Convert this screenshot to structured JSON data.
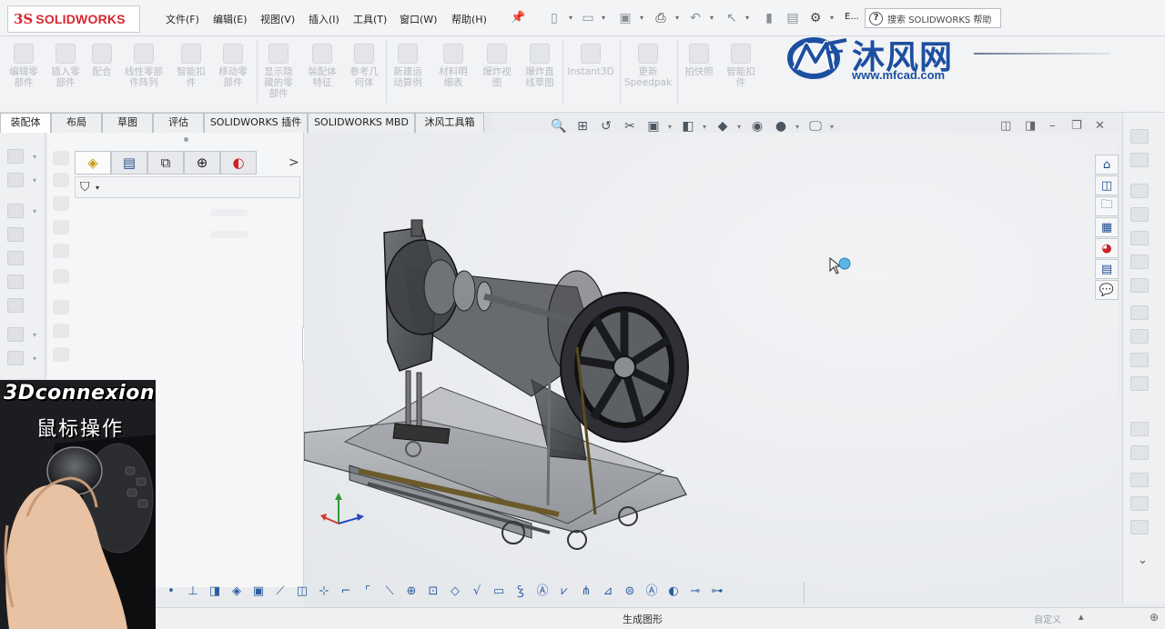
{
  "app": {
    "brand_mark": "3S",
    "brand_name": "SOLIDWORKS"
  },
  "menu": [
    {
      "label": "文件(F)"
    },
    {
      "label": "编辑(E)"
    },
    {
      "label": "视图(V)"
    },
    {
      "label": "插入(I)"
    },
    {
      "label": "工具(T)"
    },
    {
      "label": "窗口(W)"
    },
    {
      "label": "帮助(H)"
    }
  ],
  "quick_access": {
    "more_label": "E..."
  },
  "search": {
    "placeholder": "搜索 SOLIDWORKS 帮助"
  },
  "watermark": {
    "title": "沐风网",
    "url": "www.mfcad.com"
  },
  "command_manager": [
    {
      "label": "编辑零\n部件"
    },
    {
      "label": "插入零\n部件"
    },
    {
      "label": "配合"
    },
    {
      "label": "线性零部\n件阵列"
    },
    {
      "label": "智能扣\n件"
    },
    {
      "label": "移动零\n部件"
    },
    {
      "label": "显示隐\n藏的零\n部件"
    },
    {
      "label": "装配体\n特征"
    },
    {
      "label": "参考几\n何体"
    },
    {
      "label": "新建运\n动算例"
    },
    {
      "label": "材料明\n细表"
    },
    {
      "label": "爆炸视\n图"
    },
    {
      "label": "爆炸直\n线草图"
    },
    {
      "label": "Instant3D"
    },
    {
      "label": "更新\nSpeedpak"
    },
    {
      "label": "拍快照"
    },
    {
      "label": "智能扣\n件"
    }
  ],
  "tabs": [
    {
      "label": "装配体"
    },
    {
      "label": "布局"
    },
    {
      "label": "草图"
    },
    {
      "label": "评估"
    },
    {
      "label": "SOLIDWORKS 插件"
    },
    {
      "label": "SOLIDWORKS MBD"
    },
    {
      "label": "沐风工具箱"
    }
  ],
  "feature_manager": {
    "tabs": [
      "feature-tree-icon",
      "property-manager-icon",
      "configuration-manager-icon",
      "dimxpert-icon",
      "display-manager-icon"
    ],
    "more_label": ">",
    "filter_icon": "filter-icon"
  },
  "overlay": {
    "title": "3Dconnexion",
    "subtitle": "鼠标操作"
  },
  "task_pane": [
    "home-icon",
    "design-library-icon",
    "file-explorer-icon",
    "view-palette-icon",
    "appearances-icon",
    "custom-properties-icon",
    "forum-icon"
  ],
  "status": {
    "message": "生成图形",
    "custom": "自定义"
  },
  "colors": {
    "accent": "#1c4fa0",
    "brand_red": "#d8262f",
    "viewport_bg": "#eceef1"
  }
}
